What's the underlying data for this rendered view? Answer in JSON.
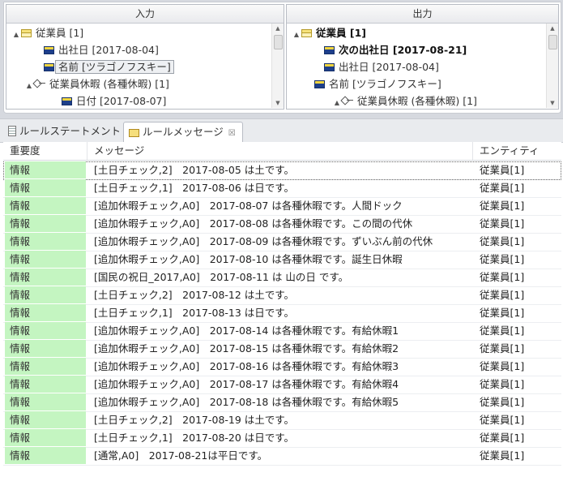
{
  "mapping": {
    "input_header": "入力",
    "output_header": "出力",
    "input_tree": [
      {
        "label": "従業員 [1]",
        "icon": "folder-icon",
        "expander": "▲",
        "bold": false,
        "selected": false
      },
      {
        "label": "出社日 [2017-08-04]",
        "icon": "field-icon",
        "expander": "",
        "bold": false,
        "selected": false
      },
      {
        "label": "名前 [ツラゴノフスキー]",
        "icon": "field-icon",
        "expander": "",
        "bold": false,
        "selected": true
      },
      {
        "label": "従業員休暇 (各種休暇) [1]",
        "icon": "relation-icon",
        "expander": "▲",
        "bold": false,
        "selected": false
      },
      {
        "label": "日付 [2017-08-07]",
        "icon": "field-icon",
        "expander": "",
        "bold": false,
        "selected": false
      }
    ],
    "output_tree": [
      {
        "label": "従業員 [1]",
        "icon": "folder-icon",
        "expander": "▲",
        "bold": true,
        "selected": false
      },
      {
        "label": "次の出社日 [2017-08-21]",
        "icon": "field-icon",
        "expander": "",
        "bold": true,
        "selected": false
      },
      {
        "label": "出社日 [2017-08-04]",
        "icon": "field-icon",
        "expander": "",
        "bold": false,
        "selected": false
      },
      {
        "label": "名前 [ツラゴノフスキー]",
        "icon": "field-icon",
        "expander": "",
        "bold": false,
        "selected": false
      },
      {
        "label": "従業員休暇 (各種休暇) [1]",
        "icon": "relation-icon",
        "expander": "▲",
        "bold": false,
        "selected": false
      }
    ]
  },
  "tabs": [
    {
      "label": "ルールステートメント",
      "icon": "document-icon",
      "active": false
    },
    {
      "label": "ルールメッセージ",
      "icon": "message-icon",
      "active": true,
      "close": "☒"
    }
  ],
  "table": {
    "columns": [
      "重要度",
      "メッセージ",
      "エンティティ"
    ],
    "rows": [
      {
        "severity": "情報",
        "message": "[土日チェック,2]　2017-08-05  は土です。",
        "entity": "従業員[1]"
      },
      {
        "severity": "情報",
        "message": "[土日チェック,1]　2017-08-06  は日です。",
        "entity": "従業員[1]"
      },
      {
        "severity": "情報",
        "message": "[追加休暇チェック,A0]　2017-08-07 は各種休暇です。人間ドック",
        "entity": "従業員[1]"
      },
      {
        "severity": "情報",
        "message": "[追加休暇チェック,A0]　2017-08-08 は各種休暇です。この間の代休",
        "entity": "従業員[1]"
      },
      {
        "severity": "情報",
        "message": "[追加休暇チェック,A0]　2017-08-09 は各種休暇です。ずいぶん前の代休",
        "entity": "従業員[1]"
      },
      {
        "severity": "情報",
        "message": "[追加休暇チェック,A0]　2017-08-10 は各種休暇です。誕生日休暇",
        "entity": "従業員[1]"
      },
      {
        "severity": "情報",
        "message": "[国民の祝日_2017,A0]　2017-08-11  は  山の日 です。",
        "entity": "従業員[1]"
      },
      {
        "severity": "情報",
        "message": "[土日チェック,2]　2017-08-12  は土です。",
        "entity": "従業員[1]"
      },
      {
        "severity": "情報",
        "message": "[土日チェック,1]　2017-08-13  は日です。",
        "entity": "従業員[1]"
      },
      {
        "severity": "情報",
        "message": "[追加休暇チェック,A0]　2017-08-14 は各種休暇です。有給休暇1",
        "entity": "従業員[1]"
      },
      {
        "severity": "情報",
        "message": "[追加休暇チェック,A0]　2017-08-15 は各種休暇です。有給休暇2",
        "entity": "従業員[1]"
      },
      {
        "severity": "情報",
        "message": "[追加休暇チェック,A0]　2017-08-16 は各種休暇です。有給休暇3",
        "entity": "従業員[1]"
      },
      {
        "severity": "情報",
        "message": "[追加休暇チェック,A0]　2017-08-17 は各種休暇です。有給休暇4",
        "entity": "従業員[1]"
      },
      {
        "severity": "情報",
        "message": "[追加休暇チェック,A0]　2017-08-18 は各種休暇です。有給休暇5",
        "entity": "従業員[1]"
      },
      {
        "severity": "情報",
        "message": "[土日チェック,2]　2017-08-19  は土です。",
        "entity": "従業員[1]"
      },
      {
        "severity": "情報",
        "message": "[土日チェック,1]　2017-08-20  は日です。",
        "entity": "従業員[1]"
      },
      {
        "severity": "情報",
        "message": "[通常,A0]　2017-08-21は平日です。",
        "entity": "従業員[1]"
      }
    ]
  },
  "colors": {
    "severity_info_bg": "#c4f5c1",
    "field_icon": "#1e3f8a",
    "folder_icon": "#f6e27c"
  }
}
